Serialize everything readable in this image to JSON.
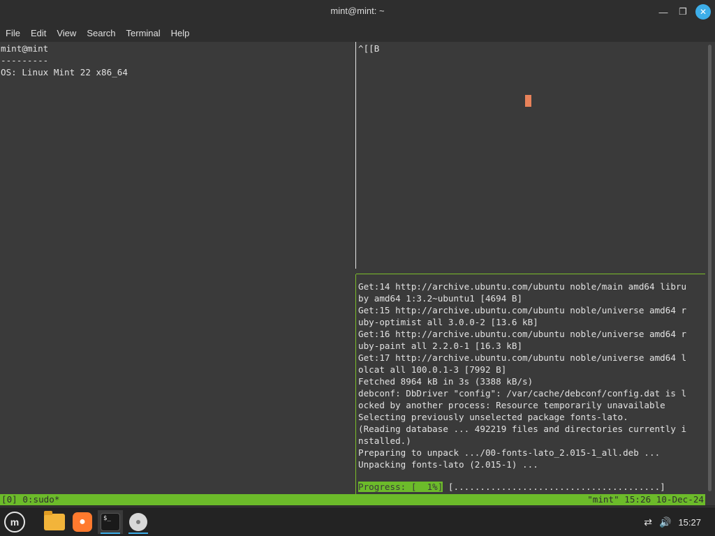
{
  "window": {
    "title": "mint@mint: ~",
    "minimize_icon": "minimize-icon",
    "maximize_icon": "maximize-icon",
    "close_icon": "close-icon"
  },
  "menubar": {
    "items": [
      "File",
      "Edit",
      "View",
      "Search",
      "Terminal",
      "Help"
    ]
  },
  "panes": {
    "left": {
      "lines": [
        "mint@mint",
        "---------",
        "OS: Linux Mint 22 x86_64"
      ]
    },
    "top_right": {
      "lines": [
        "^[[B"
      ]
    },
    "bottom_right": {
      "lines": [
        "Get:14 http://archive.ubuntu.com/ubuntu noble/main amd64 libru",
        "by amd64 1:3.2~ubuntu1 [4694 B]",
        "Get:15 http://archive.ubuntu.com/ubuntu noble/universe amd64 r",
        "uby-optimist all 3.0.0-2 [13.6 kB]",
        "Get:16 http://archive.ubuntu.com/ubuntu noble/universe amd64 r",
        "uby-paint all 2.2.0-1 [16.3 kB]",
        "Get:17 http://archive.ubuntu.com/ubuntu noble/universe amd64 l",
        "olcat all 100.0.1-3 [7992 B]",
        "Fetched 8964 kB in 3s (3388 kB/s)",
        "debconf: DbDriver \"config\": /var/cache/debconf/config.dat is l",
        "ocked by another process: Resource temporarily unavailable",
        "Selecting previously unselected package fonts-lato.",
        "(Reading database ... 492219 files and directories currently i",
        "nstalled.)",
        "Preparing to unpack .../00-fonts-lato_2.015-1_all.deb ...",
        "Unpacking fonts-lato (2.015-1) ..."
      ],
      "progress_label": "Progress: [  1%]",
      "progress_bar": " [.......................................]"
    }
  },
  "tmux_status": {
    "left": "[0] 0:sudo*",
    "right": "\"mint\" 15:26 10-Dec-24"
  },
  "taskbar": {
    "apps": [
      {
        "name": "Files",
        "icon": "folder-icon"
      },
      {
        "name": "Firefox",
        "icon": "firefox-icon"
      },
      {
        "name": "Terminal",
        "icon": "terminal-icon",
        "label": "$_"
      },
      {
        "name": "Disc",
        "icon": "disc-icon"
      }
    ],
    "menu_icon": "mint-menu-icon",
    "network_icon": "network-disconnected-icon",
    "volume_icon": "volume-icon",
    "clock": "15:27"
  },
  "colors": {
    "accent": "#3daee9",
    "tmux_green": "#6cbb2a",
    "cursor": "#e8825a",
    "terminal_bg": "#3a3a3a"
  }
}
